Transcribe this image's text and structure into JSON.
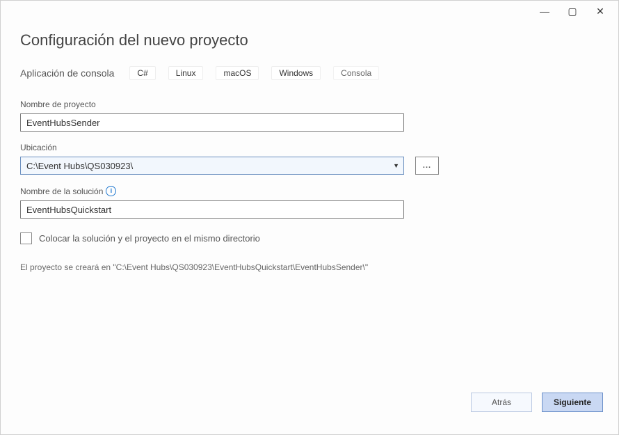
{
  "window": {
    "minimize_glyph": "—",
    "maximize_glyph": "▢",
    "close_glyph": "✕"
  },
  "heading": "Configuración del nuevo proyecto",
  "template": {
    "name": "Aplicación de consola",
    "tags": [
      "C#",
      "Linux",
      "macOS",
      "Windows",
      "Consola"
    ]
  },
  "fields": {
    "project_name": {
      "label": "Nombre de proyecto",
      "value": "EventHubsSender"
    },
    "location": {
      "label": "Ubicación",
      "value": "C:\\Event Hubs\\QS030923\\",
      "browse_label": "..."
    },
    "solution_name": {
      "label": "Nombre de la solución",
      "info_glyph": "i",
      "value": "EventHubsQuickstart"
    },
    "same_dir": {
      "label": "Colocar la solución y el proyecto en el mismo directorio"
    }
  },
  "preview_text": "El proyecto se creará en \"C:\\Event Hubs\\QS030923\\EventHubsQuickstart\\EventHubsSender\\\"",
  "buttons": {
    "back": "Atrás",
    "next": "Siguiente"
  }
}
